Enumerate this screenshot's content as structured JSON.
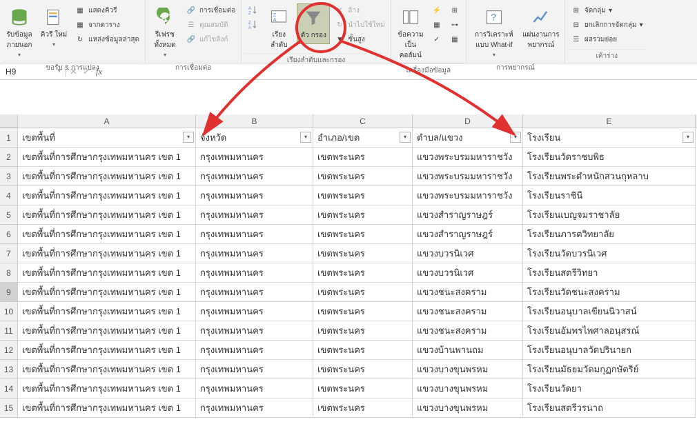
{
  "ribbon": {
    "groups": {
      "get_transform": {
        "label": "ขอรับ & การแปลง",
        "get_external": "รับข้อมูล\nภายนอก",
        "query": "คิวรี\nใหม่",
        "show_queries": "แสดงคิวรี",
        "from_table": "จากตาราง",
        "recent_sources": "แหล่งข้อมูลล่าสุด"
      },
      "connections": {
        "label": "การเชื่อมต่อ",
        "refresh_all": "รีเฟรช\nทั้งหมด",
        "connections": "การเชื่อมต่อ",
        "properties": "คุณสมบัติ",
        "edit_links": "แก้ไขลิงก์"
      },
      "sort_filter": {
        "label": "เรียงลำดับและกรอง",
        "sort": "เรียง\nลำดับ",
        "filter": "ตัว\nกรอง",
        "clear": "ล้าง",
        "reapply": "นำไปใช้ใหม่",
        "advanced": "ชั้นสูง"
      },
      "data_tools": {
        "label": "เครื่องมือข้อมูล",
        "text_to_cols": "ข้อความ\nเป็นคอลัมน์"
      },
      "forecast": {
        "label": "การพยากรณ์",
        "what_if": "การวิเคราะห์แบบ\nWhat-if",
        "forecast_sheet": "แผ่นงานการ\nพยากรณ์"
      },
      "outline": {
        "label": "เค้าร่าง",
        "group": "จัดกลุ่ม",
        "ungroup": "ยกเลิกการจัดกลุ่ม",
        "subtotal": "ผลรวมย่อย"
      }
    }
  },
  "namebox": "H9",
  "columns": [
    "A",
    "B",
    "C",
    "D",
    "E"
  ],
  "headers": {
    "a": "เขตพื้นที่",
    "b": "จังหวัด",
    "c": "อำเภอ/เขต",
    "d": "ตำบล/แขวง",
    "e": "โรงเรียน"
  },
  "rows": [
    {
      "a": "เขตพื้นที่การศึกษากรุงเทพมหานคร เขต 1",
      "b": "กรุงเทพมหานคร",
      "c": "เขตพระนคร",
      "d": "แขวงพระบรมมหาราชวัง",
      "e": "โรงเรียนวัดราชบพิธ"
    },
    {
      "a": "เขตพื้นที่การศึกษากรุงเทพมหานคร เขต 1",
      "b": "กรุงเทพมหานคร",
      "c": "เขตพระนคร",
      "d": "แขวงพระบรมมหาราชวัง",
      "e": "โรงเรียนพระตำหนักสวนกุหลาบ"
    },
    {
      "a": "เขตพื้นที่การศึกษากรุงเทพมหานคร เขต 1",
      "b": "กรุงเทพมหานคร",
      "c": "เขตพระนคร",
      "d": "แขวงพระบรมมหาราชวัง",
      "e": "โรงเรียนราชินี"
    },
    {
      "a": "เขตพื้นที่การศึกษากรุงเทพมหานคร เขต 1",
      "b": "กรุงเทพมหานคร",
      "c": "เขตพระนคร",
      "d": "แขวงสำราญราษฎร์",
      "e": "โรงเรียนเบญจมราชาลัย"
    },
    {
      "a": "เขตพื้นที่การศึกษากรุงเทพมหานคร เขต 1",
      "b": "กรุงเทพมหานคร",
      "c": "เขตพระนคร",
      "d": "แขวงสำราญราษฎร์",
      "e": "โรงเรียนภารตวิทยาลัย"
    },
    {
      "a": "เขตพื้นที่การศึกษากรุงเทพมหานคร เขต 1",
      "b": "กรุงเทพมหานคร",
      "c": "เขตพระนคร",
      "d": "แขวงบวรนิเวศ",
      "e": "โรงเรียนวัดบวรนิเวศ"
    },
    {
      "a": "เขตพื้นที่การศึกษากรุงเทพมหานคร เขต 1",
      "b": "กรุงเทพมหานคร",
      "c": "เขตพระนคร",
      "d": "แขวงบวรนิเวศ",
      "e": "โรงเรียนสตรีวิทยา"
    },
    {
      "a": "เขตพื้นที่การศึกษากรุงเทพมหานคร เขต 1",
      "b": "กรุงเทพมหานคร",
      "c": "เขตพระนคร",
      "d": "แขวงชนะสงคราม",
      "e": "โรงเรียนวัดชนะสงคราม"
    },
    {
      "a": "เขตพื้นที่การศึกษากรุงเทพมหานคร เขต 1",
      "b": "กรุงเทพมหานคร",
      "c": "เขตพระนคร",
      "d": "แขวงชนะสงคราม",
      "e": "โรงเรียนอนุบาลเขียนนิวาสน์"
    },
    {
      "a": "เขตพื้นที่การศึกษากรุงเทพมหานคร เขต 1",
      "b": "กรุงเทพมหานคร",
      "c": "เขตพระนคร",
      "d": "แขวงชนะสงคราม",
      "e": "โรงเรียนอัมพรไพศาลอนุสรณ์"
    },
    {
      "a": "เขตพื้นที่การศึกษากรุงเทพมหานคร เขต 1",
      "b": "กรุงเทพมหานคร",
      "c": "เขตพระนคร",
      "d": "แขวงบ้านพานถม",
      "e": "โรงเรียนอนุบาลวัดปรินายก"
    },
    {
      "a": "เขตพื้นที่การศึกษากรุงเทพมหานคร เขต 1",
      "b": "กรุงเทพมหานคร",
      "c": "เขตพระนคร",
      "d": "แขวงบางขุนพรหม",
      "e": "โรงเรียนมัธยมวัดมกุฏกษัตริย์"
    },
    {
      "a": "เขตพื้นที่การศึกษากรุงเทพมหานคร เขต 1",
      "b": "กรุงเทพมหานคร",
      "c": "เขตพระนคร",
      "d": "แขวงบางขุนพรหม",
      "e": "โรงเรียนวัดยา"
    },
    {
      "a": "เขตพื้นที่การศึกษากรุงเทพมหานคร เขต 1",
      "b": "กรุงเทพมหานคร",
      "c": "เขตพระนคร",
      "d": "แขวงบางขุนพรหม",
      "e": "โรงเรียนสตรีวรนาถ"
    }
  ]
}
